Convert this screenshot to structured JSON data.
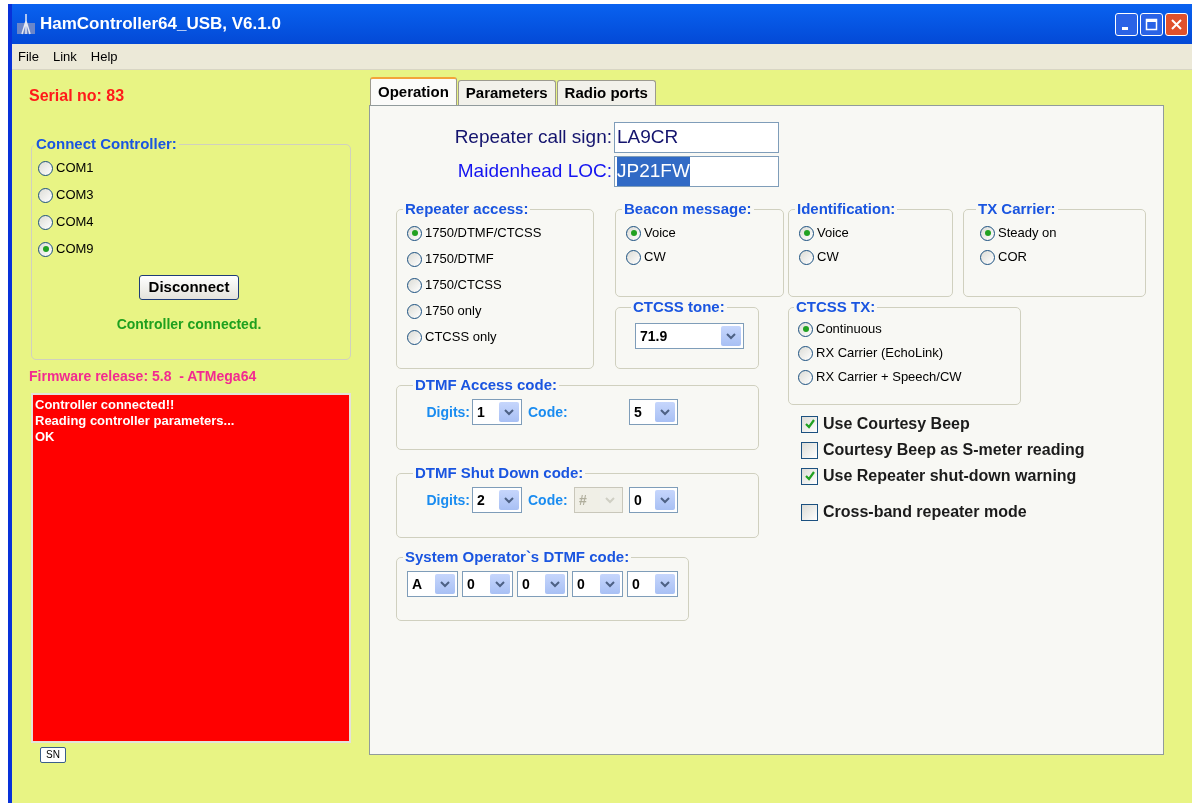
{
  "window": {
    "title": "HamController64_USB, V6.1.0"
  },
  "menu": [
    "File",
    "Link",
    "Help"
  ],
  "serial_no": "Serial no: 83",
  "connect_controller": {
    "title": "Connect Controller:",
    "ports": [
      {
        "label": "COM1",
        "selected": false
      },
      {
        "label": "COM3",
        "selected": false
      },
      {
        "label": "COM4",
        "selected": false
      },
      {
        "label": "COM9",
        "selected": true
      }
    ],
    "button": "Disconnect",
    "status": "Controller connected."
  },
  "firmware": "Firmware release: 5.8  - ATMega64",
  "log": [
    "Controller connected!!",
    "Reading controller parameters...",
    "OK"
  ],
  "sn_button": "SN",
  "tabs": [
    {
      "label": "Operation",
      "selected": true
    },
    {
      "label": "Parameters",
      "selected": false
    },
    {
      "label": "Radio ports",
      "selected": false
    }
  ],
  "fields": [
    {
      "label": "Repeater call sign:",
      "value": "LA9CR",
      "color": "#14146e",
      "highlighted": false
    },
    {
      "label": "Maidenhead LOC:",
      "value": "JP21FW",
      "color": "#1414f0",
      "highlighted": true
    }
  ],
  "repeater_access": {
    "title": "Repeater access:",
    "options": [
      {
        "label": "1750/DTMF/CTCSS",
        "selected": true
      },
      {
        "label": "1750/DTMF",
        "selected": false
      },
      {
        "label": "1750/CTCSS",
        "selected": false
      },
      {
        "label": "1750 only",
        "selected": false
      },
      {
        "label": "CTCSS only",
        "selected": false
      }
    ]
  },
  "beacon_message": {
    "title": "Beacon message:",
    "options": [
      {
        "label": "Voice",
        "selected": true
      },
      {
        "label": "CW",
        "selected": false
      }
    ]
  },
  "identification": {
    "title": "Identification:",
    "options": [
      {
        "label": "Voice",
        "selected": true
      },
      {
        "label": "CW",
        "selected": false
      }
    ]
  },
  "tx_carrier": {
    "title": "TX Carrier:",
    "options": [
      {
        "label": "Steady on",
        "selected": true
      },
      {
        "label": "COR",
        "selected": false
      }
    ]
  },
  "ctcss_tone": {
    "title": "CTCSS tone:",
    "value": "71.9"
  },
  "ctcss_tx": {
    "title": "CTCSS TX:",
    "options": [
      {
        "label": "Continuous",
        "selected": true
      },
      {
        "label": "RX Carrier (EchoLink)",
        "selected": false
      },
      {
        "label": "RX Carrier + Speech/CW",
        "selected": false
      }
    ]
  },
  "dtmf_access": {
    "title": "DTMF Access code:",
    "digits_label": "Digits:",
    "digits": "1",
    "code_label": "Code:",
    "codes": [
      {
        "value": "5",
        "disabled": false
      }
    ]
  },
  "dtmf_shutdown": {
    "title": "DTMF Shut Down code:",
    "digits_label": "Digits:",
    "digits": "2",
    "code_label": "Code:",
    "codes": [
      {
        "value": "#",
        "disabled": true
      },
      {
        "value": "0",
        "disabled": false
      }
    ]
  },
  "sysop_code": {
    "title": "System Operator`s DTMF code:",
    "codes": [
      "A",
      "0",
      "0",
      "0",
      "0"
    ]
  },
  "checkboxes": [
    {
      "label": "Use Courtesy Beep",
      "checked": true
    },
    {
      "label": "Courtesy Beep as S-meter reading",
      "checked": false
    },
    {
      "label": "Use Repeater shut-down warning",
      "checked": true
    },
    {
      "label": "Cross-band repeater mode",
      "checked": false
    }
  ]
}
